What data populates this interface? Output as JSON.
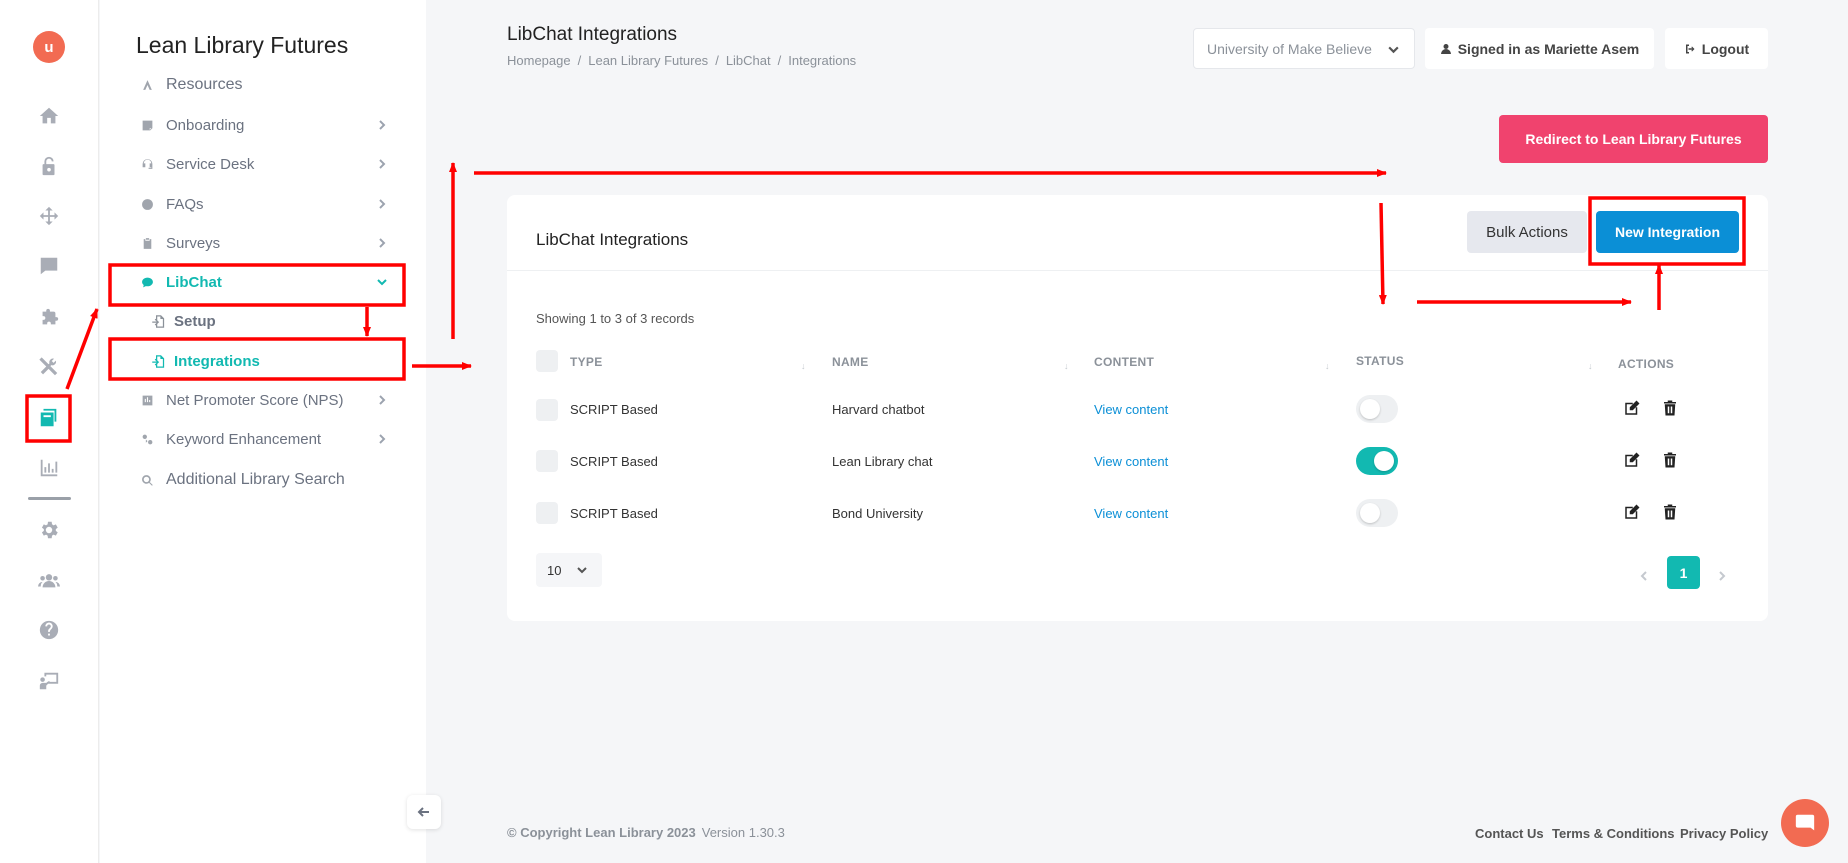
{
  "app": {
    "logo_text": "u",
    "panel_title": "Lean Library Futures"
  },
  "rail": {
    "icons": [
      "home-icon",
      "unlock-icon",
      "move-icon",
      "chat-icon",
      "puzzle-icon",
      "tools-icon",
      "integrations-icon",
      "chart-icon",
      "gear-icon",
      "users-icon",
      "help-icon",
      "teacher-icon"
    ],
    "active": "integrations-icon"
  },
  "sidebar": {
    "items": [
      {
        "label": "Resources",
        "icon": "resources-icon"
      },
      {
        "label": "Onboarding",
        "icon": "onboarding-icon"
      },
      {
        "label": "Service Desk",
        "icon": "headset-icon"
      },
      {
        "label": "FAQs",
        "icon": "question-icon"
      },
      {
        "label": "Surveys",
        "icon": "clipboard-icon"
      },
      {
        "label": "LibChat",
        "icon": "comment-icon"
      },
      {
        "label": "Net Promoter Score (NPS)",
        "icon": "nps-icon"
      },
      {
        "label": "Keyword Enhancement",
        "icon": "keyword-icon"
      },
      {
        "label": "Additional Library Search",
        "icon": "search-icon"
      }
    ],
    "subitems": [
      {
        "label": "Setup",
        "icon": "file-import-icon"
      },
      {
        "label": "Integrations",
        "icon": "file-import-icon"
      }
    ]
  },
  "header": {
    "title": "LibChat Integrations",
    "breadcrumb": [
      "Homepage",
      "Lean Library Futures",
      "LibChat",
      "Integrations"
    ],
    "breadcrumb_sep": "/",
    "org_select": "University of Make Believe",
    "signed_in": "Signed in as Mariette Asem",
    "logout": "Logout",
    "redirect": "Redirect to Lean Library Futures"
  },
  "card": {
    "title": "LibChat Integrations",
    "bulk_actions": "Bulk Actions",
    "new_integration": "New Integration",
    "records_text": "Showing 1 to 3 of 3 records",
    "columns": [
      "TYPE",
      "NAME",
      "CONTENT",
      "STATUS",
      "ACTIONS"
    ],
    "rows": [
      {
        "type": "SCRIPT Based",
        "name": "Harvard chatbot",
        "content": "View content",
        "status": false
      },
      {
        "type": "SCRIPT Based",
        "name": "Lean Library chat",
        "content": "View content",
        "status": true
      },
      {
        "type": "SCRIPT Based",
        "name": "Bond University",
        "content": "View content",
        "status": false
      }
    ],
    "per_page": "10",
    "current_page": "1"
  },
  "footer": {
    "copyright": "© Copyright Lean Library 2023",
    "version": "Version 1.30.3",
    "links": [
      "Contact Us",
      "Terms & Conditions",
      "Privacy Policy"
    ]
  },
  "colors": {
    "accent": "#12b9b1",
    "primary_button": "#0b8fd6",
    "redirect_button": "#f0436e",
    "annotation": "#ff0000"
  }
}
